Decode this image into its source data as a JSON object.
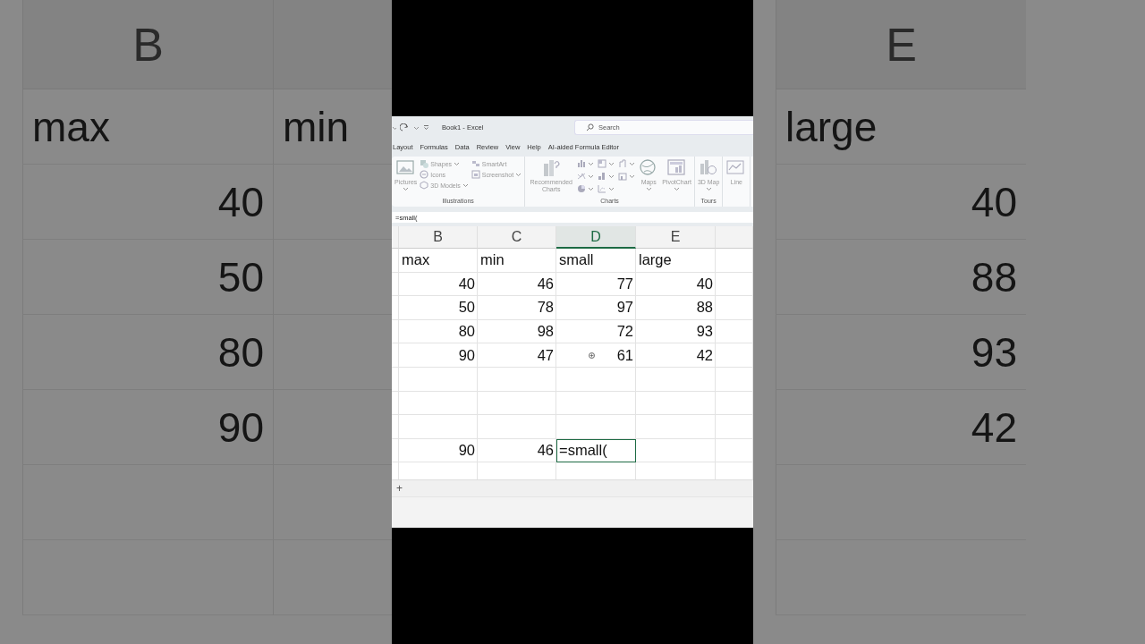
{
  "backdrop": {
    "left": [
      {
        "header": "B",
        "cells": [
          {
            "text": "max",
            "kind": "text"
          },
          {
            "text": "40",
            "kind": "number"
          },
          {
            "text": "50",
            "kind": "number"
          },
          {
            "text": "80",
            "kind": "number"
          },
          {
            "text": "90",
            "kind": "number"
          }
        ]
      },
      {
        "cells": [
          {
            "text": "min",
            "kind": "text"
          }
        ]
      }
    ],
    "right": [
      {
        "header": "E",
        "cells": [
          {
            "text": "large",
            "kind": "text"
          },
          {
            "text": "40",
            "kind": "number"
          },
          {
            "text": "88",
            "kind": "number"
          },
          {
            "text": "93",
            "kind": "number"
          },
          {
            "text": "42",
            "kind": "number"
          }
        ]
      }
    ]
  },
  "window": {
    "title": "Book1  -  Excel",
    "search": {
      "placeholder": "Search"
    }
  },
  "tabs": [
    {
      "label": "Layout",
      "selected": false
    },
    {
      "label": "Formulas",
      "selected": false
    },
    {
      "label": "Data",
      "selected": false
    },
    {
      "label": "Review",
      "selected": false
    },
    {
      "label": "View",
      "selected": false
    },
    {
      "label": "Help",
      "selected": false
    },
    {
      "label": "AI-aided Formula Editor",
      "selected": false
    }
  ],
  "ribbon": [
    {
      "label": "Illustrations",
      "items": [
        {
          "kind": "large",
          "label": "Pictures",
          "dropdown": true
        },
        {
          "kind": "column",
          "items": [
            {
              "label": "Shapes",
              "dropdown": true
            },
            {
              "label": "Icons",
              "dropdown": false
            },
            {
              "label": "3D Models",
              "dropdown": true
            }
          ]
        },
        {
          "kind": "column",
          "items": [
            {
              "label": "SmartArt",
              "dropdown": false
            },
            {
              "label": "Screenshot",
              "dropdown": true
            }
          ]
        }
      ]
    },
    {
      "label": "Charts",
      "items": [
        {
          "kind": "large",
          "label": "Recommended Charts",
          "dropdown": false
        },
        {
          "kind": "chart-grid"
        },
        {
          "kind": "large",
          "label": "Maps",
          "dropdown": true
        },
        {
          "kind": "large",
          "label": "PivotChart",
          "dropdown": true
        }
      ]
    },
    {
      "label": "Tours",
      "items": [
        {
          "kind": "large",
          "label": "3D Map",
          "dropdown": true
        }
      ]
    },
    {
      "items": [
        {
          "kind": "large",
          "label": "Line",
          "dropdown": false
        }
      ]
    }
  ],
  "formula_bar": {
    "value": "=small("
  },
  "sheet": {
    "columns": [
      {
        "label": "B",
        "selected": false
      },
      {
        "label": "C",
        "selected": false
      },
      {
        "label": "D",
        "selected": true
      },
      {
        "label": "E",
        "selected": false
      }
    ],
    "rows": [
      [
        {
          "text": "max",
          "kind": "text"
        },
        {
          "text": "min",
          "kind": "text"
        },
        {
          "text": "small",
          "kind": "text"
        },
        {
          "text": "large",
          "kind": "text"
        }
      ],
      [
        {
          "text": "40",
          "kind": "number"
        },
        {
          "text": "46",
          "kind": "number"
        },
        {
          "text": "77",
          "kind": "number"
        },
        {
          "text": "40",
          "kind": "number"
        }
      ],
      [
        {
          "text": "50",
          "kind": "number"
        },
        {
          "text": "78",
          "kind": "number"
        },
        {
          "text": "97",
          "kind": "number"
        },
        {
          "text": "88",
          "kind": "number"
        }
      ],
      [
        {
          "text": "80",
          "kind": "number"
        },
        {
          "text": "98",
          "kind": "number"
        },
        {
          "text": "72",
          "kind": "number"
        },
        {
          "text": "93",
          "kind": "number"
        }
      ],
      [
        {
          "text": "90",
          "kind": "number"
        },
        {
          "text": "47",
          "kind": "number"
        },
        {
          "text": "61",
          "kind": "number"
        },
        {
          "text": "42",
          "kind": "number"
        }
      ],
      [],
      [],
      [],
      [
        {
          "text": "90",
          "kind": "number"
        },
        {
          "text": "46",
          "kind": "number"
        },
        {
          "text": "=small(",
          "kind": "editing"
        },
        {
          "kind": "empty"
        }
      ],
      []
    ]
  },
  "sheet_bar": {
    "add_label": "+"
  }
}
